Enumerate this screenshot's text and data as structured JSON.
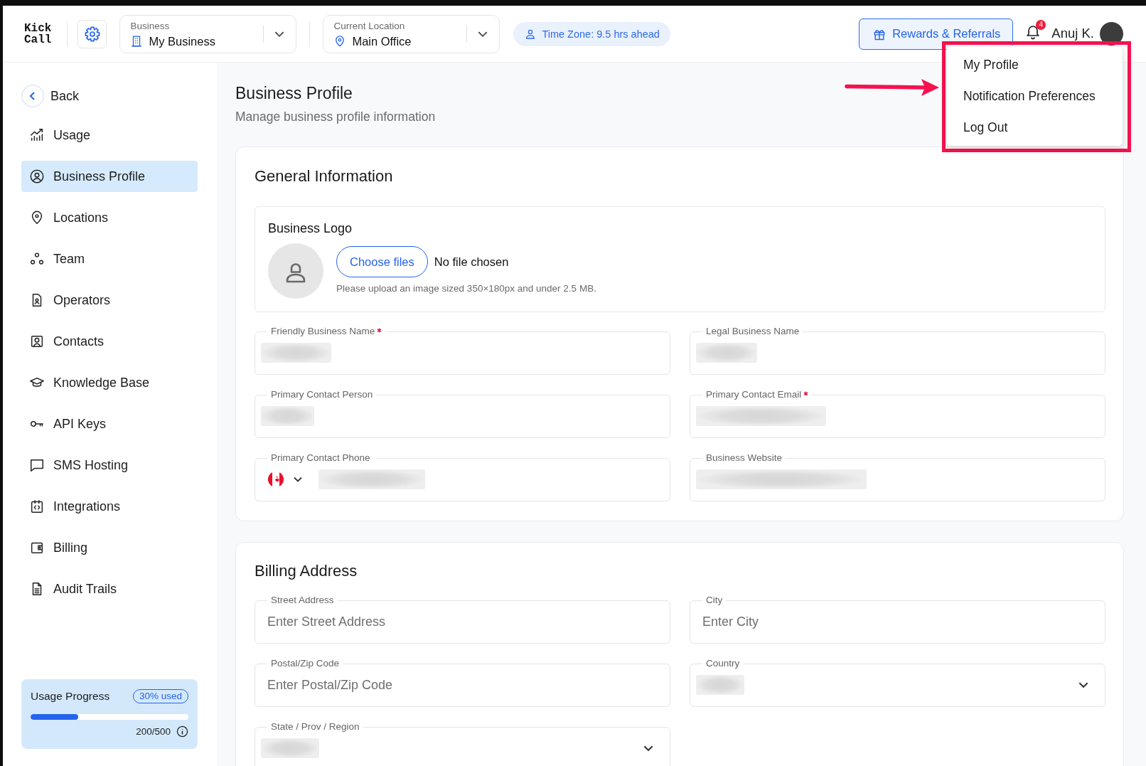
{
  "header": {
    "logo": "Kick Call",
    "business_select": {
      "label": "Business",
      "value": "My Business"
    },
    "location_select": {
      "label": "Current Location",
      "value": "Main Office"
    },
    "timezone": "Time Zone: 9.5 hrs ahead",
    "rewards_button": "Rewards & Referrals",
    "notification_count": "4",
    "user_name": "Anuj K."
  },
  "user_menu": {
    "items": [
      {
        "label": "My Profile"
      },
      {
        "label": "Notification Preferences"
      },
      {
        "label": "Log Out"
      }
    ]
  },
  "sidebar": {
    "back": "Back",
    "items": [
      {
        "label": "Usage",
        "selected": false
      },
      {
        "label": "Business Profile",
        "selected": true
      },
      {
        "label": "Locations",
        "selected": false
      },
      {
        "label": "Team",
        "selected": false
      },
      {
        "label": "Operators",
        "selected": false
      },
      {
        "label": "Contacts",
        "selected": false
      },
      {
        "label": "Knowledge Base",
        "selected": false
      },
      {
        "label": "API Keys",
        "selected": false
      },
      {
        "label": "SMS Hosting",
        "selected": false
      },
      {
        "label": "Integrations",
        "selected": false
      },
      {
        "label": "Billing",
        "selected": false
      },
      {
        "label": "Audit Trails",
        "selected": false
      }
    ],
    "usage_card": {
      "title": "Usage Progress",
      "badge": "30% used",
      "level": 0.3,
      "count": "200/500"
    }
  },
  "page": {
    "title": "Business Profile",
    "subtitle": "Manage business profile information"
  },
  "general_information": {
    "title": "General Information",
    "logo": {
      "title": "Business Logo",
      "button": "Choose files",
      "file_status": "No file chosen",
      "hint": "Please upload an image sized 350×180px and under 2.5 MB."
    },
    "fields": [
      {
        "label": "Friendly Business Name",
        "kind": "text",
        "required": true,
        "redacted": true
      },
      {
        "label": "Legal Business Name",
        "kind": "text",
        "required": false,
        "redacted": true
      },
      {
        "label": "Primary Contact Person",
        "kind": "text",
        "required": false,
        "redacted": true
      },
      {
        "label": "Primary Contact Email",
        "kind": "text",
        "required": true,
        "redacted": true
      },
      {
        "label": "Primary Contact Phone",
        "kind": "phone",
        "required": false,
        "redacted": true
      },
      {
        "label": "Business Website",
        "kind": "text",
        "required": false,
        "redacted": true
      }
    ]
  },
  "billing_address": {
    "title": "Billing Address",
    "fields": [
      {
        "label": "Street Address",
        "kind": "text",
        "required": false,
        "redacted": false,
        "placeholder": "Enter Street Address"
      },
      {
        "label": "City",
        "kind": "text",
        "required": false,
        "redacted": false,
        "placeholder": "Enter City"
      },
      {
        "label": "Postal/Zip Code",
        "kind": "text",
        "required": false,
        "redacted": false,
        "placeholder": "Enter Postal/Zip Code"
      },
      {
        "label": "Country",
        "kind": "select",
        "required": false,
        "redacted": true
      },
      {
        "label": "State / Prov / Region",
        "kind": "select",
        "required": false,
        "redacted": true
      }
    ]
  }
}
